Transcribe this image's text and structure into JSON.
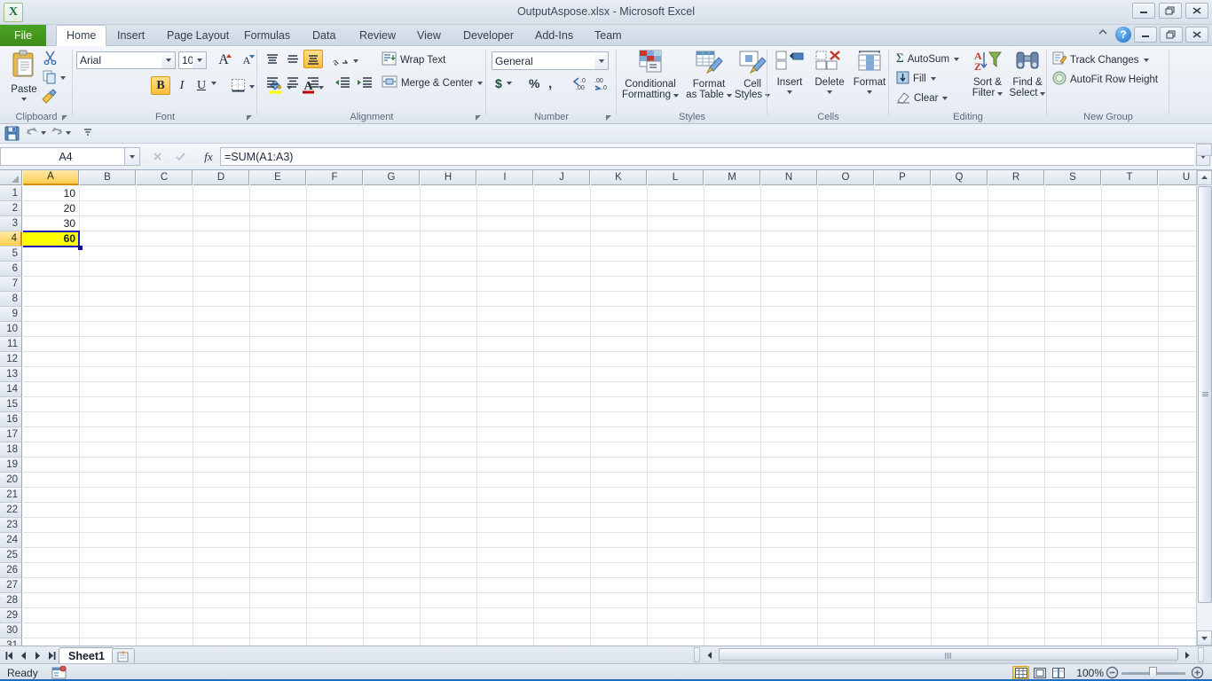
{
  "window": {
    "title": "OutputAspose.xlsx  -  Microsoft Excel",
    "app_logo": "X",
    "minimize": "minimize-icon",
    "restore": "restore-icon",
    "close": "close-icon"
  },
  "tabs": [
    {
      "label": "File",
      "active": false,
      "kind": "file"
    },
    {
      "label": "Home",
      "active": true
    },
    {
      "label": "Insert",
      "active": false
    },
    {
      "label": "Page Layout",
      "active": false
    },
    {
      "label": "Formulas",
      "active": false
    },
    {
      "label": "Data",
      "active": false
    },
    {
      "label": "Review",
      "active": false
    },
    {
      "label": "View",
      "active": false
    },
    {
      "label": "Developer",
      "active": false
    },
    {
      "label": "Add-Ins",
      "active": false
    },
    {
      "label": "Team",
      "active": false
    }
  ],
  "tab_right": {
    "minimize_ribbon": "chevron-up-icon",
    "help": "?"
  },
  "ribbon": {
    "clipboard": {
      "label": "Clipboard",
      "paste": "Paste",
      "cut": "cut-icon",
      "copy": "copy-icon",
      "format_painter": "format-painter-icon"
    },
    "font": {
      "label": "Font",
      "font_name": "Arial",
      "font_size": "10",
      "grow_font": "A",
      "shrink_font": "A",
      "bold": "B",
      "italic": "I",
      "underline": "U",
      "borders": "borders-icon",
      "fill_color": "fill-color-icon",
      "font_color": "font-color-icon",
      "bold_active": true
    },
    "alignment": {
      "label": "Alignment",
      "align_top": "align-top-icon",
      "align_middle": "align-middle-icon",
      "align_bottom": "align-bottom-icon",
      "orientation": "orientation-icon",
      "wrap_text": "Wrap Text",
      "align_left": "align-left-icon",
      "align_center": "align-center-icon",
      "align_right": "align-right-icon",
      "decrease_indent": "decrease-indent-icon",
      "increase_indent": "increase-indent-icon",
      "merge_center": "Merge & Center",
      "align_bottom_active": true
    },
    "number": {
      "label": "Number",
      "format": "General",
      "accounting": "$",
      "percent": "%",
      "comma": ",",
      "increase_decimal": "increase-decimal-icon",
      "decrease_decimal": "decrease-decimal-icon"
    },
    "styles": {
      "label": "Styles",
      "conditional_formatting": "Conditional\nFormatting",
      "conditional_formatting_l1": "Conditional",
      "conditional_formatting_l2": "Formatting",
      "format_as_table_l1": "Format",
      "format_as_table_l2": "as Table",
      "cell_styles_l1": "Cell",
      "cell_styles_l2": "Styles"
    },
    "cells": {
      "label": "Cells",
      "insert": "Insert",
      "delete": "Delete",
      "format": "Format"
    },
    "editing": {
      "label": "Editing",
      "autosum": "AutoSum",
      "fill": "Fill",
      "clear": "Clear",
      "sort_filter_l1": "Sort &",
      "sort_filter_l2": "Filter",
      "find_select_l1": "Find &",
      "find_select_l2": "Select"
    },
    "new_group": {
      "label": "New Group",
      "track_changes": "Track Changes",
      "autofit_row_height": "AutoFit Row Height"
    }
  },
  "qat": {
    "save": "save-icon",
    "undo": "undo-icon",
    "redo": "redo-icon",
    "customize": "customize-qat-icon"
  },
  "formula_bar": {
    "name_box": "A4",
    "cancel": "cancel-icon",
    "enter": "enter-icon",
    "insert_function": "fx",
    "formula": "=SUM(A1:A3)",
    "expand": "chevron-down-icon"
  },
  "grid": {
    "columns": [
      "A",
      "B",
      "C",
      "D",
      "E",
      "F",
      "G",
      "H",
      "I",
      "J",
      "K",
      "L",
      "M",
      "N",
      "O",
      "P",
      "Q",
      "R",
      "S",
      "T",
      "U"
    ],
    "rows": [
      "1",
      "2",
      "3",
      "4",
      "5",
      "6",
      "7",
      "8",
      "9",
      "10",
      "11",
      "12",
      "13",
      "14",
      "15",
      "16",
      "17",
      "18",
      "19",
      "20",
      "21",
      "22",
      "23",
      "24",
      "25",
      "26",
      "27",
      "28",
      "29",
      "30",
      "31"
    ],
    "selected_column": "A",
    "selected_row": "4",
    "active_cell": "A4",
    "cells": [
      {
        "col": 0,
        "row": 0,
        "value": "10",
        "bold": false,
        "fill": ""
      },
      {
        "col": 0,
        "row": 1,
        "value": "20",
        "bold": false,
        "fill": ""
      },
      {
        "col": 0,
        "row": 2,
        "value": "30",
        "bold": false,
        "fill": ""
      },
      {
        "col": 0,
        "row": 3,
        "value": "60",
        "bold": true,
        "fill": "#ffff00"
      }
    ]
  },
  "sheet_tabs": {
    "first": "first-sheet-icon",
    "prev": "prev-sheet-icon",
    "next": "next-sheet-icon",
    "last": "last-sheet-icon",
    "sheets": [
      "Sheet1"
    ],
    "insert_sheet": "insert-worksheet-icon"
  },
  "status_bar": {
    "status": "Ready",
    "macro_record": "record-macro-icon",
    "view_normal": "normal-view-icon",
    "view_page_layout": "page-layout-view-icon",
    "view_page_break": "page-break-view-icon",
    "zoom": "100%",
    "zoom_out": "zoom-out-icon",
    "zoom_in": "zoom-in-icon",
    "active_view": "normal"
  },
  "colors": {
    "accent_green": "#4ba322",
    "selection_blue": "#1a1ab4",
    "header_orange": "#ffcd51",
    "cell_fill_yellow": "#ffff00",
    "status_strip": "#1e6cc0"
  }
}
